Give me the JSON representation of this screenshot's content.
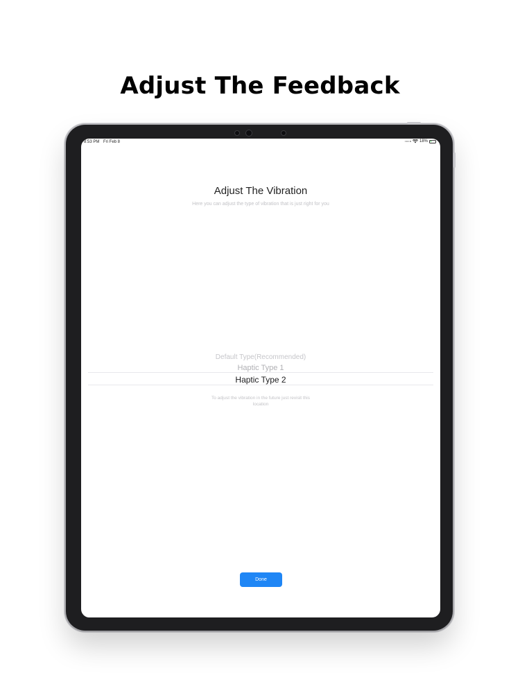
{
  "headline": "Adjust The Feedback",
  "status_bar": {
    "time": "8:53 PM",
    "date": "Fri Feb 8",
    "battery_text": "18%",
    "battery_level": 0.18
  },
  "screen": {
    "title": "Adjust The Vibration",
    "subtitle": "Here you can adjust the type of vibration that is just right for you",
    "picker": {
      "options": [
        "Default Type(Recommended)",
        "Haptic Type 1",
        "Haptic Type 2"
      ],
      "selected": "Haptic Type 2"
    },
    "hint": "To adjust the vibration in the future just revisit this location",
    "done_label": "Done"
  },
  "colors": {
    "accent": "#1f86f5",
    "device_bezel": "#1e1e20"
  }
}
